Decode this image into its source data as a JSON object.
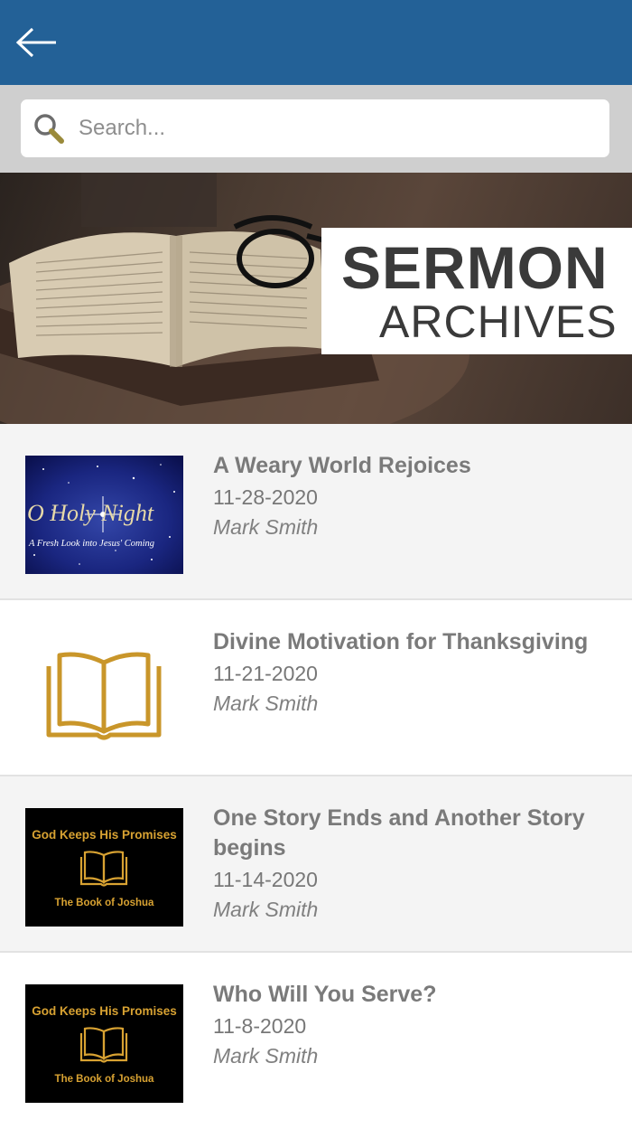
{
  "search": {
    "placeholder": "Search..."
  },
  "banner": {
    "title": "SERMON",
    "subtitle": "ARCHIVES"
  },
  "thumbs": {
    "holy_night_script": "O Holy Night",
    "holy_night_caption": "A Fresh Look into Jesus' Coming",
    "promises_title": "God Keeps His Promises",
    "promises_series": "The Book of Joshua"
  },
  "sermons": [
    {
      "title": "A Weary World Rejoices",
      "date": "11-28-2020",
      "author": "Mark Smith",
      "thumb": "holy-night"
    },
    {
      "title": "Divine Motivation for Thanksgiving",
      "date": "11-21-2020",
      "author": "Mark Smith",
      "thumb": "book-icon"
    },
    {
      "title": "One Story Ends and Another Story begins",
      "date": "11-14-2020",
      "author": "Mark Smith",
      "thumb": "promises"
    },
    {
      "title": "Who Will You Serve?",
      "date": "11-8-2020",
      "author": "Mark Smith",
      "thumb": "promises"
    }
  ],
  "colors": {
    "appbar": "#236197",
    "gold": "#c9962a",
    "text_gray": "#7a7a7a"
  }
}
